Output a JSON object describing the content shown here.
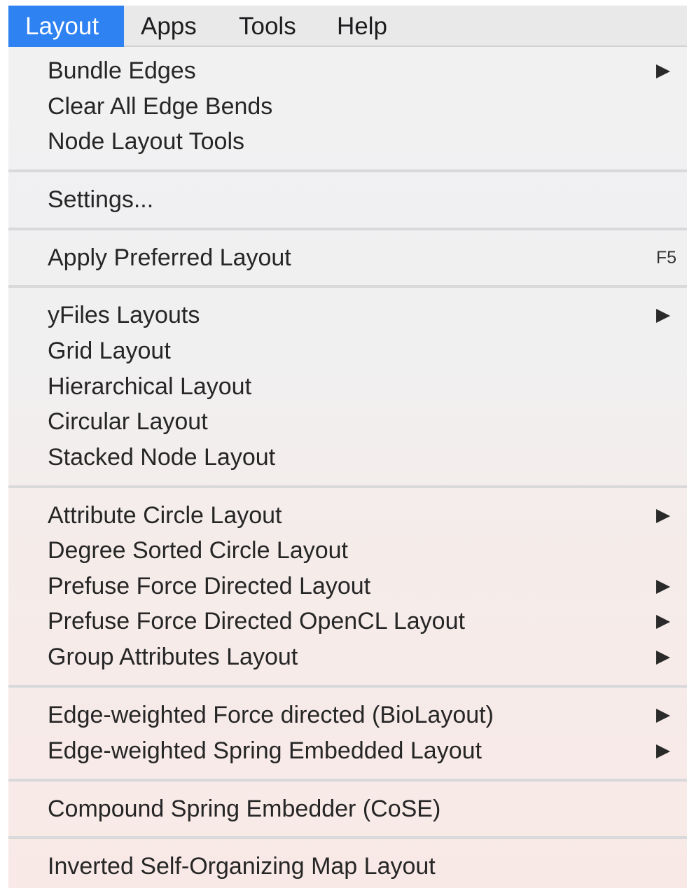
{
  "menubar": {
    "items": [
      {
        "label": "Layout",
        "active": true
      },
      {
        "label": "Apps"
      },
      {
        "label": "Tools"
      },
      {
        "label": "Help"
      }
    ]
  },
  "menu": {
    "items": [
      {
        "label": "Bundle Edges",
        "submenu": true
      },
      {
        "label": "Clear All Edge Bends"
      },
      {
        "label": "Node Layout Tools"
      },
      {
        "label": "Settings..."
      },
      {
        "label": "Apply Preferred Layout",
        "shortcut": "F5"
      },
      {
        "label": "yFiles Layouts",
        "submenu": true
      },
      {
        "label": "Grid Layout"
      },
      {
        "label": "Hierarchical Layout"
      },
      {
        "label": "Circular Layout"
      },
      {
        "label": "Stacked Node Layout"
      },
      {
        "label": "Attribute Circle Layout",
        "submenu": true
      },
      {
        "label": "Degree Sorted Circle Layout"
      },
      {
        "label": "Prefuse Force Directed Layout",
        "submenu": true
      },
      {
        "label": "Prefuse Force Directed OpenCL Layout",
        "submenu": true
      },
      {
        "label": "Group Attributes Layout",
        "submenu": true
      },
      {
        "label": "Edge-weighted Force directed (BioLayout)",
        "submenu": true
      },
      {
        "label": "Edge-weighted Spring Embedded Layout",
        "submenu": true
      },
      {
        "label": "Compound Spring Embedder (CoSE)"
      },
      {
        "label": "Inverted Self-Organizing Map Layout"
      }
    ]
  },
  "icons": {
    "submenu_arrow": "submenu-arrow-icon"
  },
  "colors": {
    "active_menu": "#2f82f2",
    "menubar_bg": "#e9e9ea"
  }
}
